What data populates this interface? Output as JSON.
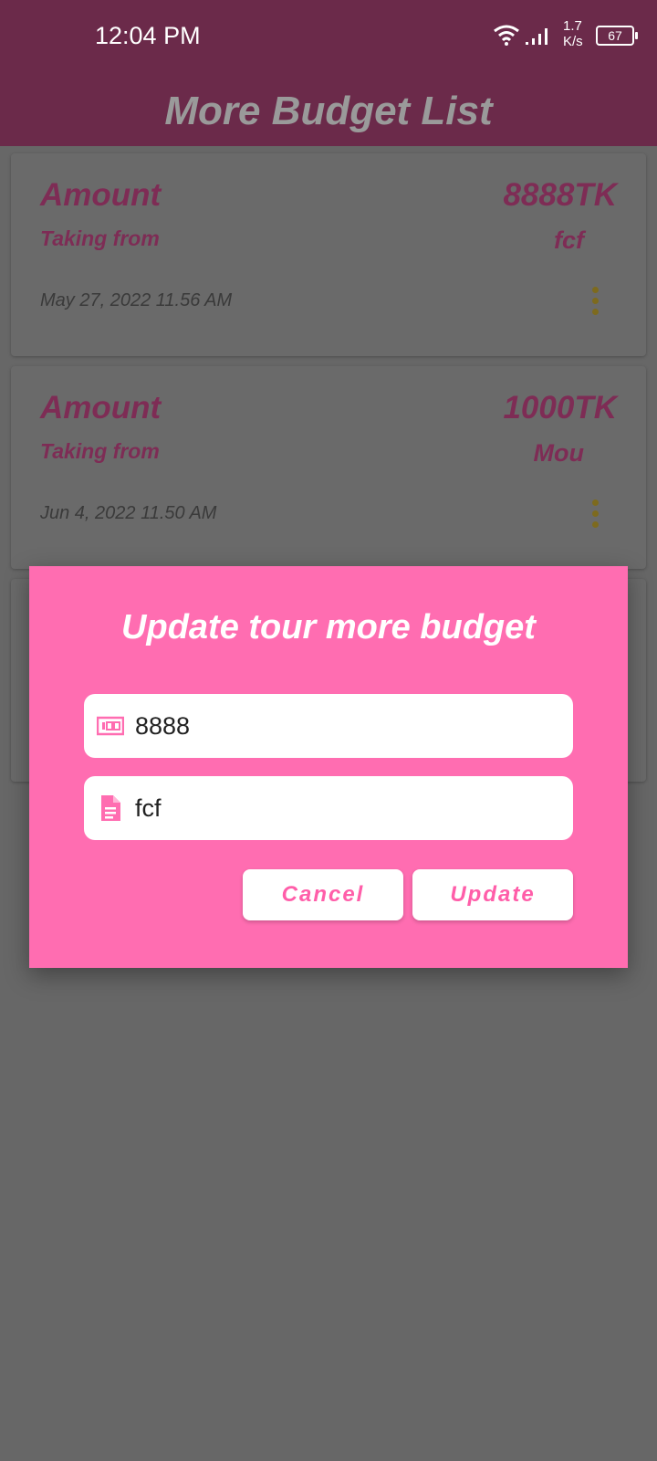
{
  "status_bar": {
    "time": "12:04 PM",
    "network_speed": "1.7\nK/s",
    "battery": "67"
  },
  "app_bar": {
    "title": "More Budget List"
  },
  "cards": [
    {
      "amount_label": "Amount",
      "amount_value": "8888TK",
      "from_label": "Taking from",
      "from_value": "fcf",
      "date": "May 27, 2022 11.56 AM"
    },
    {
      "amount_label": "Amount",
      "amount_value": "1000TK",
      "from_label": "Taking from",
      "from_value": "Mou",
      "date": "Jun 4, 2022 11.50 AM"
    }
  ],
  "dialog": {
    "title": "Update tour more budget",
    "amount_field": {
      "value": "8888",
      "icon": "money-icon"
    },
    "source_field": {
      "value": "fcf",
      "icon": "document-icon"
    },
    "cancel_label": "Cancel",
    "update_label": "Update"
  },
  "colors": {
    "dialog_bg": "#ff6db1",
    "accent_text": "#ff5ea9",
    "app_bar_bg": "#6b2a4a"
  }
}
